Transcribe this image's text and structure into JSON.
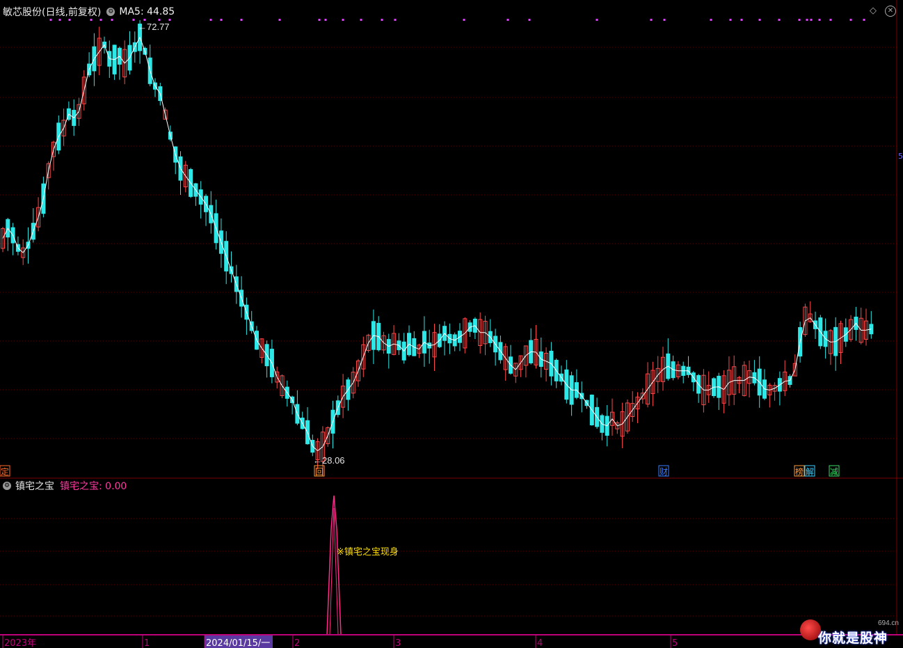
{
  "header": {
    "stock_title": "敏芯股份(日线,前复权)",
    "ma_label": "MA5: 44.85",
    "settings_icon": "gear-icon"
  },
  "sub_header": {
    "indicator_name": "镇宅之宝",
    "indicator_value_label": "镇宅之宝: 0.00",
    "settings_icon": "gear-icon"
  },
  "watermark": {
    "text": "你就是股神",
    "url": "694.cn"
  },
  "chart_data": [
    {
      "type": "candlestick",
      "title": "敏芯股份(日线,前复权)",
      "series": [
        {
          "name": "MA5",
          "last_value": 44.85,
          "color": "#ffffff"
        }
      ],
      "annotations": [
        {
          "text": "72.77",
          "kind": "period_high",
          "value": 72.77
        },
        {
          "text": "28.06",
          "kind": "period_low",
          "value": 28.06
        }
      ],
      "event_markers": [
        {
          "text": "定",
          "color": "#ff6a2a"
        },
        {
          "text": "回",
          "color": "#ff9a3a"
        },
        {
          "text": "财",
          "color": "#3a7bff"
        },
        {
          "text": "榜",
          "color": "#ff9a3a"
        },
        {
          "text": "解",
          "color": "#3ad0ff"
        },
        {
          "text": "减",
          "color": "#3add6a"
        }
      ],
      "right_edge_label": "5",
      "colors": {
        "up": "#ff4a4a",
        "down": "#2ee8e8",
        "ma": "#ffffff",
        "dot": "#e040fb",
        "grid": "#5a0000"
      }
    },
    {
      "type": "line",
      "title": "镇宅之宝",
      "series": [
        {
          "name": "镇宅之宝",
          "last_value": 0.0,
          "color": "#ff2a8a"
        }
      ],
      "annotations": [
        {
          "text": "※镇宅之宝现身",
          "color": "#ffe000"
        }
      ]
    }
  ],
  "x_axis": {
    "labels": [
      {
        "text": "2023年"
      },
      {
        "text": "1"
      },
      {
        "text": "2024/01/15/一",
        "highlight": true
      },
      {
        "text": "2"
      },
      {
        "text": "3"
      },
      {
        "text": "4"
      },
      {
        "text": "5"
      }
    ]
  }
}
